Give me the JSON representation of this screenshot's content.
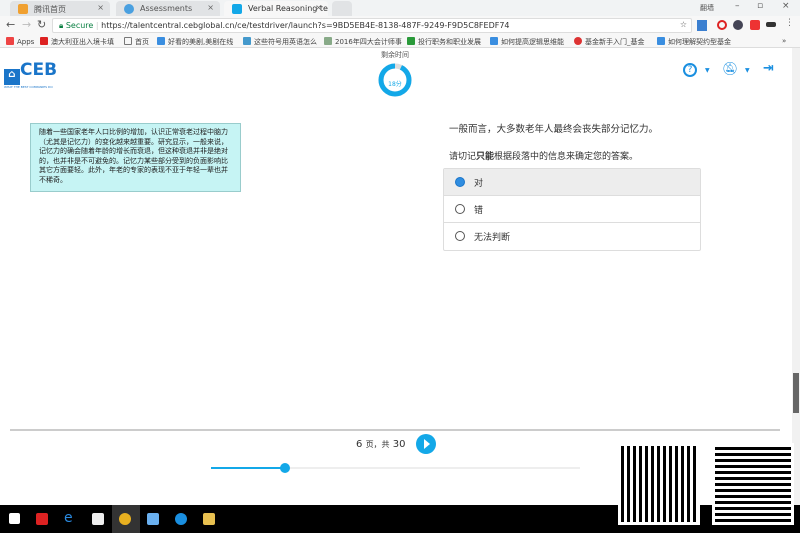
{
  "browser": {
    "tabs": [
      {
        "label": "腾讯首页"
      },
      {
        "label": "Assessments"
      },
      {
        "label": "Verbal Reasoning test | T",
        "active": true
      }
    ],
    "window_user": "翻墙",
    "secure_label": "Secure",
    "url": "https://talentcentral.cebglobal.cn/ce/testdriver/launch?s=9BD5EB4E-8138-487F-9249-F9D5C8FEDF74",
    "bookmarks": [
      {
        "label": "Apps"
      },
      {
        "label": "澳大利亚出入境卡填"
      },
      {
        "label": "首页"
      },
      {
        "label": "好看的美剧,美剧在线"
      },
      {
        "label": "这些符号用英语怎么"
      },
      {
        "label": "2016年四大会计师事"
      },
      {
        "label": "投行职务和职业发展"
      },
      {
        "label": "如何提高逻辑思维能"
      },
      {
        "label": "基金新手入门_基金"
      },
      {
        "label": "如何理解契约型基金"
      }
    ],
    "more": "»"
  },
  "header": {
    "logo": "CEB",
    "logo_tagline": "WHAT THE BEST COMPANIES DO",
    "timer_label": "剩余时间",
    "timer_value": "18分",
    "timer_fraction": 0.93,
    "accent": "#13a8e8"
  },
  "passage": "随着一些国家老年人口比例的增加，认识正常衰老过程中脑力（尤其是记忆力）的变化越来越重要。研究显示，一般来说，记忆力的确会随着年龄的增长而衰退，但这种衰退并非是绝对的，也并非是不可避免的。记忆力某些部分受到的负面影响比其它方面要轻。此外，年老的专家的表现不亚于年轻一辈也并不稀奇。",
  "question": "一般而言，大多数老年人最终会丧失部分记忆力。",
  "instruction": {
    "pre": "请切记",
    "bold": "只能",
    "post": "根据段落中的信息来确定您的答案。"
  },
  "options": [
    {
      "label": "对",
      "selected": true
    },
    {
      "label": "错"
    },
    {
      "label": "无法判断"
    }
  ],
  "footer": {
    "page_current": "6",
    "page_sep": "页，共",
    "page_total": "30",
    "progress": 0.2
  }
}
